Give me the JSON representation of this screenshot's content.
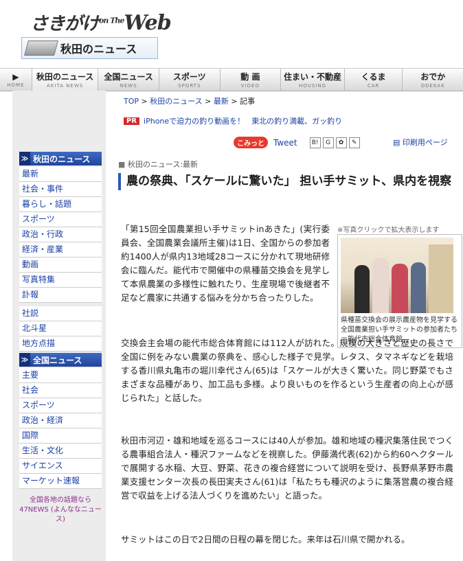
{
  "header": {
    "logo_main": "さきがけ",
    "logo_on": "on The",
    "logo_web": "Web",
    "section_title": "秋田のニュース"
  },
  "nav": [
    {
      "jp": "",
      "en": "HOME"
    },
    {
      "jp": "秋田のニュース",
      "en": "AKITA NEWS"
    },
    {
      "jp": "全国ニュース",
      "en": "NEWS"
    },
    {
      "jp": "スポーツ",
      "en": "SPORTS"
    },
    {
      "jp": "動 画",
      "en": "VIDEO"
    },
    {
      "jp": "住まい・不動産",
      "en": "HOUSING"
    },
    {
      "jp": "くるま",
      "en": "CAR"
    },
    {
      "jp": "おでか",
      "en": "ODEKAK"
    }
  ],
  "breadcrumb": {
    "top": "TOP",
    "akita": "秋田のニュース",
    "latest": "最新",
    "current": "記事"
  },
  "pr": {
    "tag": "PR",
    "link1": "iPhoneで迫力の釣り動画を！",
    "link2": "東北の釣り満載、ガッ釣り"
  },
  "social": {
    "komitto": "こみっと",
    "tweet": "Tweet",
    "print": "印刷用ページ"
  },
  "article": {
    "kind": "秋田のニュース:最新",
    "headline": "農の祭典、「スケールに驚いた」 担い手サミット、県内を視察",
    "photo_note": "※写真クリックで拡大表示します",
    "photo_caption": "県種苗交換会の展示農産物を見学する全国農業担い手サミットの参加者たち＝能代市総合体育館",
    "p1": "「第15回全国農業担い手サミットinあきた」(実行委員会、全国農業会議所主催)は1日、全国からの参加者約1400人が県内13地域28コースに分かれて現地研修会に臨んだ。能代市で開催中の県種苗交換会を見学して本県農業の多様性に触れたり、生産現場で後継者不足など農家に共通する悩みを分かち合ったりした。",
    "p2": "交換会主会場の能代市総合体育館には112人が訪れた。規模の大きさと歴史の長さで全国に例をみない農業の祭典を、感心した様子で見学。レタス、タマネギなどを栽培する香川県丸亀市の堀川幸代さん(65)は「スケールが大きく驚いた。同じ野菜でもさまざまな品種があり、加工品も多様。より良いものを作るという生産者の向上心が感じられた」と話した。",
    "p3": "秋田市河辺・雄和地域を巡るコースには40人が参加。雄和地域の種沢集落住民でつくる農事組合法人・種沢ファームなどを視察した。伊藤満代表(62)から約60ヘクタールで展開する水稲、大豆、野菜、花きの複合経営について説明を受け、長野県茅野市農業支援センター次長の長田実夫さん(61)は「私たちも種沢のように集落営農の複合経営で収益を上げる法人づくりを進めたい」と語った。",
    "p4": "サミットはこの日で2日間の日程の幕を閉じた。来年は石川県で開かれる。"
  },
  "sidebar": {
    "head1": "秋田のニュース",
    "items1": [
      "最新",
      "社会・事件",
      "暮らし・話題",
      "スポーツ",
      "政治・行政",
      "経済・産業",
      "動画",
      "写真特集",
      "訃報"
    ],
    "items2": [
      "社説",
      "北斗星",
      "地方点描"
    ],
    "head2": "全国ニュース",
    "items3": [
      "主要",
      "社会",
      "スポーツ",
      "政治・経済",
      "国際",
      "生活・文化",
      "サイエンス",
      "マーケット速報"
    ],
    "note": "全国各地の話題なら 47NEWS (よんななニュース)"
  },
  "colors": {
    "accent": "#2c59b5",
    "pr_red": "#d42a2a",
    "link": "#1a3fa6"
  }
}
